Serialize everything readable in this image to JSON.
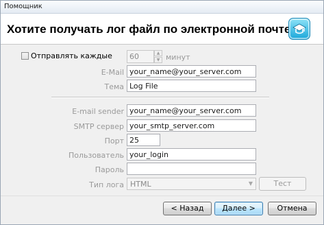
{
  "window": {
    "title": "Помощник"
  },
  "header": {
    "heading": "Хотите получать лог файл по электронной почте?",
    "logo_icon": "app-logo-icon"
  },
  "schedule": {
    "checkbox_label": "Отправлять каждые",
    "checked": false,
    "interval_value": "60",
    "unit": "минут"
  },
  "email": {
    "email_label": "E-Mail",
    "email_value": "your_name@your_server.com",
    "subject_label": "Тема",
    "subject_value": "Log File"
  },
  "smtp": {
    "sender_label": "E-mail sender",
    "sender_value": "your_name@your_server.com",
    "server_label": "SMTP сервер",
    "server_value": "your_smtp_server.com",
    "port_label": "Порт",
    "port_value": "25",
    "user_label": "Пользователь",
    "user_value": "your_login",
    "password_label": "Пароль",
    "password_value": "",
    "logtype_label": "Тип лога",
    "logtype_value": "HTML",
    "test_label": "Тест"
  },
  "footer": {
    "back_label": "< Назад",
    "next_label": "Далее >",
    "cancel_label": "Отмена"
  },
  "colors": {
    "accent": "#3c7fb1",
    "disabled_text": "#9a9a9a",
    "logo": "#1aa7da"
  }
}
